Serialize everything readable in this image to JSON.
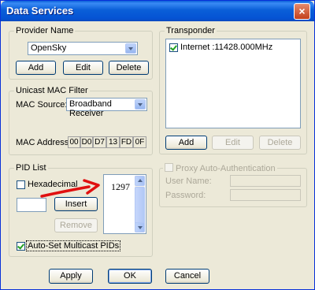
{
  "window": {
    "title": "Data Services",
    "close_glyph": "×"
  },
  "provider": {
    "legend": "Provider Name",
    "selected": "OpenSky",
    "buttons": {
      "add": "Add",
      "edit": "Edit",
      "delete": "Delete"
    }
  },
  "transponder": {
    "legend": "Transponder",
    "items": [
      {
        "label": "Internet :11428.000MHz",
        "checked": true
      }
    ],
    "buttons": {
      "add": "Add",
      "edit": "Edit",
      "delete": "Delete"
    }
  },
  "unicast": {
    "legend": "Unicast MAC Filter",
    "mac_source_label": "MAC Source:",
    "mac_source_value": "Broadband Receiver",
    "mac_address_label": "MAC Address:",
    "mac_octets": [
      "00",
      "D0",
      "D7",
      "13",
      "FD",
      "0F"
    ]
  },
  "proxy": {
    "legend": "Proxy Auto-Authentication",
    "user_name_label": "User Name:",
    "password_label": "Password:"
  },
  "pid": {
    "legend": "PID List",
    "hexadecimal_label": "Hexadecimal",
    "insert_label": "Insert",
    "remove_label": "Remove",
    "list_items": [
      "1297"
    ],
    "auto_set_label": "Auto-Set Multicast PIDs"
  },
  "footer": {
    "apply": "Apply",
    "ok": "OK",
    "cancel": "Cancel"
  },
  "colors": {
    "annotation_arrow": "#e01010",
    "title_bar": "#0a5fd8"
  }
}
